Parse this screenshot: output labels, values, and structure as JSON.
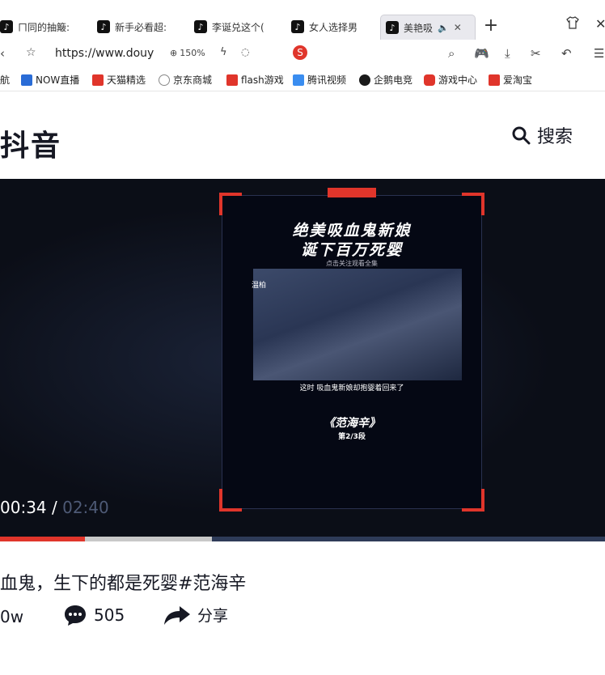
{
  "browser": {
    "tabs": [
      {
        "label": "ㄇ同的抽簸:",
        "active": false
      },
      {
        "label": "新手必看超:",
        "active": false
      },
      {
        "label": "李诞兑这个(",
        "active": false
      },
      {
        "label": "女人选择男",
        "active": false
      },
      {
        "label": "美艳吸",
        "active": true
      }
    ],
    "new_tab": "+",
    "url": "https://www.douy",
    "zoom": "150%",
    "bookmarks": [
      {
        "label": "航",
        "color": "#555"
      },
      {
        "label": "NOW直播",
        "color": "#2a6cd6"
      },
      {
        "label": "天猫精选",
        "color": "#e0352b"
      },
      {
        "label": "京东商城",
        "color": "#888"
      },
      {
        "label": "flash游戏",
        "color": "#e0352b"
      },
      {
        "label": "腾讯视频",
        "color": "#3a8df0"
      },
      {
        "label": "企鹅电竞",
        "color": "#1a1a1a"
      },
      {
        "label": "游戏中心",
        "color": "#e0352b"
      },
      {
        "label": "爱淘宝",
        "color": "#e0352b"
      }
    ]
  },
  "site": {
    "logo": "抖音",
    "search_label": "搜索"
  },
  "player": {
    "poster": {
      "title_line1": "绝美吸血鬼新娘",
      "title_line2": "诞下百万死婴",
      "subtitle": "点击关注观看全集",
      "still_label": "温柏",
      "caption": "这时 吸血鬼新娘却抱婴着回来了",
      "show": "《范海辛》",
      "episode": "第2/3段"
    },
    "current_time": "00:34",
    "separator": " / ",
    "duration": "02:40",
    "progress": 0.14,
    "buffered": 0.35
  },
  "video": {
    "title": "血鬼，生下的都是死婴#范海辛",
    "likes": "0w",
    "comments": "505",
    "share_label": "分享"
  },
  "colors": {
    "accent": "#e0352b",
    "player_bg": "#0b0e17",
    "text": "#161823"
  }
}
